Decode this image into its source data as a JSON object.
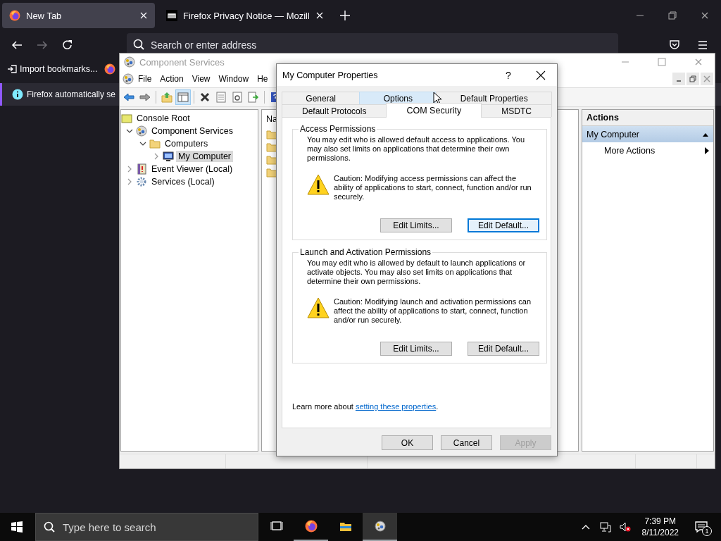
{
  "browser": {
    "tabs": [
      {
        "title": "New Tab",
        "selected": true,
        "kind": "newtab"
      },
      {
        "title": "Firefox Privacy Notice — Mozill",
        "selected": false,
        "kind": "site"
      }
    ],
    "address_bar": {
      "placeholder": "Search or enter address"
    },
    "bookmarks": [
      {
        "label": "Import bookmarks...",
        "kind": "import"
      },
      {
        "kind": "logo"
      }
    ],
    "notification": {
      "text": "Firefox automatically se"
    }
  },
  "component_services": {
    "title": "Component Services",
    "menu": [
      "File",
      "Action",
      "View",
      "Window",
      "He"
    ],
    "toolbar": [
      {
        "kind": "back"
      },
      {
        "kind": "forward"
      },
      {
        "kind": "separator"
      },
      {
        "kind": "up"
      },
      {
        "kind": "tree",
        "pressed": true
      },
      {
        "kind": "separator"
      },
      {
        "kind": "delete"
      },
      {
        "kind": "properties"
      },
      {
        "kind": "refresh"
      },
      {
        "kind": "export"
      },
      {
        "kind": "separator"
      },
      {
        "kind": "help"
      }
    ],
    "tree": [
      {
        "label": "Console Root",
        "kind": "root",
        "selected": false,
        "children": [
          {
            "label": "Component Services",
            "kind": "component",
            "expanded": true,
            "selected": false,
            "children": [
              {
                "label": "Computers",
                "kind": "folder",
                "expanded": true,
                "selected": false,
                "children": [
                  {
                    "label": "My Computer",
                    "kind": "computer",
                    "expanded": false,
                    "selected": true
                  }
                ]
              }
            ]
          },
          {
            "label": "Event Viewer (Local)",
            "kind": "event",
            "expanded": false,
            "selected": false
          },
          {
            "label": "Services (Local)",
            "kind": "services",
            "expanded": false,
            "selected": false
          }
        ]
      }
    ],
    "list": {
      "columns": [
        "Na"
      ],
      "rows": [
        {
          "kind": "folder"
        },
        {
          "kind": "folder"
        },
        {
          "kind": "folder"
        },
        {
          "kind": "folder"
        }
      ]
    },
    "actions": {
      "title": "Actions",
      "sections": [
        {
          "label": "My Computer",
          "expanded": true,
          "items": [
            {
              "label": "More Actions",
              "kind": "submenu"
            }
          ]
        }
      ]
    }
  },
  "dialog": {
    "title": "My Computer Properties",
    "help": "?",
    "tab_rows": [
      [
        {
          "label": "General",
          "selected": false,
          "hovered": false
        },
        {
          "label": "Options",
          "selected": false,
          "hovered": true
        },
        {
          "label": "Default Properties",
          "selected": false,
          "hovered": false
        }
      ],
      [
        {
          "label": "Default Protocols",
          "selected": false,
          "hovered": false
        },
        {
          "label": "COM Security",
          "selected": true,
          "hovered": false
        },
        {
          "label": "MSDTC",
          "selected": false,
          "hovered": false
        }
      ]
    ],
    "groups": [
      {
        "title": "Access Permissions",
        "description": "You may edit who is allowed default access to applications. You may also set limits on applications that determine their own permissions.",
        "caution": "Caution: Modifying access permissions can affect the ability of applications to start, connect, function and/or run securely.",
        "buttons": [
          {
            "label": "Edit Limits...",
            "focused": false
          },
          {
            "label": "Edit Default...",
            "focused": true
          }
        ]
      },
      {
        "title": "Launch and Activation Permissions",
        "description": "You may edit who is allowed by default to launch applications or activate objects. You may also set limits on applications that determine their own permissions.",
        "caution": "Caution: Modifying launch and activation permissions can affect the ability of applications to start, connect, function and/or run securely.",
        "buttons": [
          {
            "label": "Edit Limits...",
            "focused": false
          },
          {
            "label": "Edit Default...",
            "focused": false
          }
        ]
      }
    ],
    "learn_more": {
      "text": "Learn more about ",
      "link": "setting these properties",
      "suffix": "."
    },
    "buttons": [
      {
        "label": "OK",
        "disabled": false
      },
      {
        "label": "Cancel",
        "disabled": false
      },
      {
        "label": "Apply",
        "disabled": true
      }
    ]
  },
  "taskbar": {
    "search": {
      "placeholder": "Type here to search"
    },
    "apps": [
      {
        "kind": "taskview",
        "running": false,
        "selected": false
      },
      {
        "kind": "browser",
        "running": true,
        "selected": false
      },
      {
        "kind": "explorer",
        "running": false,
        "selected": false
      },
      {
        "kind": "component",
        "running": true,
        "selected": true
      }
    ],
    "time": "7:39 PM",
    "date": "8/11/2022",
    "notifications": "1"
  }
}
